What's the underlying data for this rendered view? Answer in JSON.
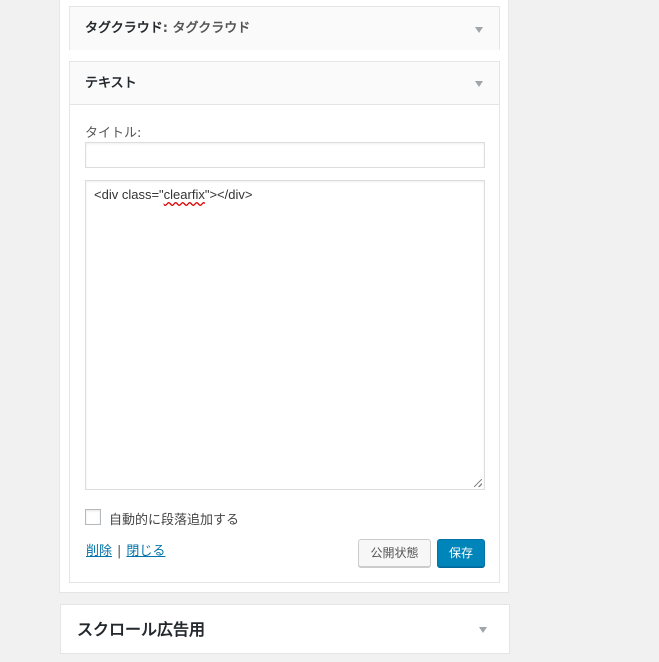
{
  "sidebar_panel": {
    "widgets": [
      {
        "title": "タグクラウド",
        "subtitle": ": タグクラウド",
        "expanded": false
      },
      {
        "title": "テキスト",
        "expanded": true,
        "title_field_label": "タイトル:",
        "title_field_value": "",
        "content_prefix": "<div class=\"",
        "content_misspelled": "clearfix",
        "content_suffix": "\"></div>",
        "autop_label": "自動的に段落追加する",
        "autop_checked": false,
        "delete_link": "削除",
        "separator": "|",
        "close_link": "閉じる",
        "visibility_button": "公開状態",
        "save_button": "保存"
      }
    ]
  },
  "next_area": {
    "title": "スクロール広告用"
  },
  "colors": {
    "background": "#f1f1f1",
    "primary_button": "#0085ba",
    "link": "#0073aa",
    "misspelling_underline": "#dd0000"
  }
}
